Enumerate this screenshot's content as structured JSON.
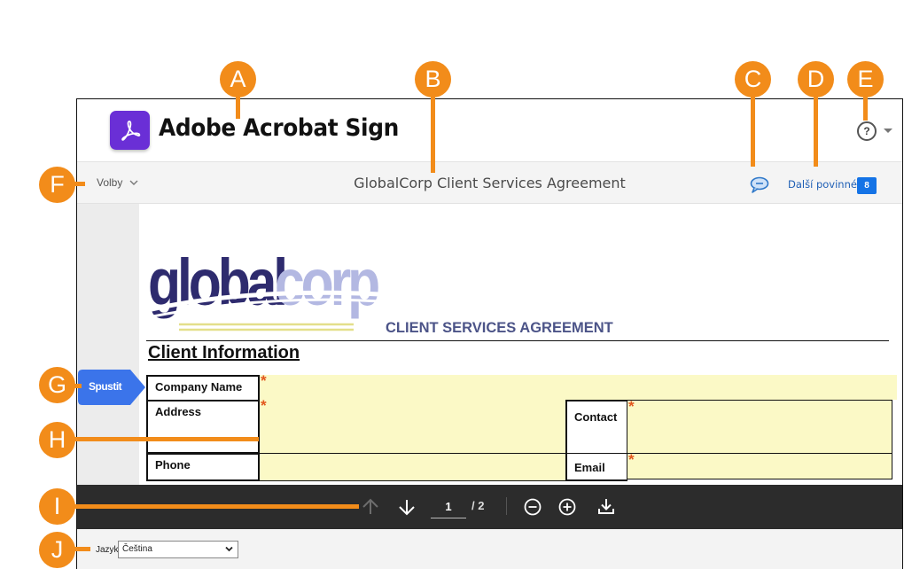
{
  "header": {
    "app_title": "Adobe Acrobat Sign",
    "logo_icon": "acrobat-logo-icon",
    "help_icon": "help-icon",
    "help_glyph": "?"
  },
  "toolbar": {
    "options_label": "Volby",
    "document_title": "GlobalCorp Client Services Agreement",
    "comment_icon": "comment-icon",
    "next_required_label": "Další povinné",
    "required_count": "8"
  },
  "document": {
    "brand_left": "global",
    "brand_right": "corp",
    "agreement_title": "CLIENT SERVICES AGREEMENT",
    "section_title": "Client Information",
    "start_tag_label": "Spustit",
    "required_marker": "*",
    "fields": [
      {
        "label": "Company Name",
        "required": true,
        "value": ""
      },
      {
        "label": "Address",
        "required": true,
        "value": ""
      },
      {
        "label": "Contact",
        "required": true,
        "value": ""
      },
      {
        "label": "Phone",
        "required": false,
        "value": ""
      },
      {
        "label": "Email",
        "required": true,
        "value": ""
      }
    ]
  },
  "navigation": {
    "current_page": "1",
    "total_pages": "/ 2",
    "prev_icon": "arrow-up-icon",
    "next_icon": "arrow-down-icon",
    "zoom_out_icon": "zoom-out-icon",
    "zoom_in_icon": "zoom-in-icon",
    "download_icon": "download-icon"
  },
  "footer": {
    "language_label": "Jazyk",
    "language_selected": "Čeština"
  },
  "callouts": [
    "A",
    "B",
    "C",
    "D",
    "E",
    "F",
    "G",
    "H",
    "I",
    "J"
  ],
  "colors": {
    "callout": "#f28c1a",
    "acrobat_purple": "#6a2fd6",
    "link_blue": "#1f5fb5",
    "badge_blue": "#1473e6",
    "field_yellow": "#fbf9c6",
    "required_star": "#e2571e",
    "nav_bar": "#2c2c2c",
    "start_tag": "#3b74ea"
  }
}
